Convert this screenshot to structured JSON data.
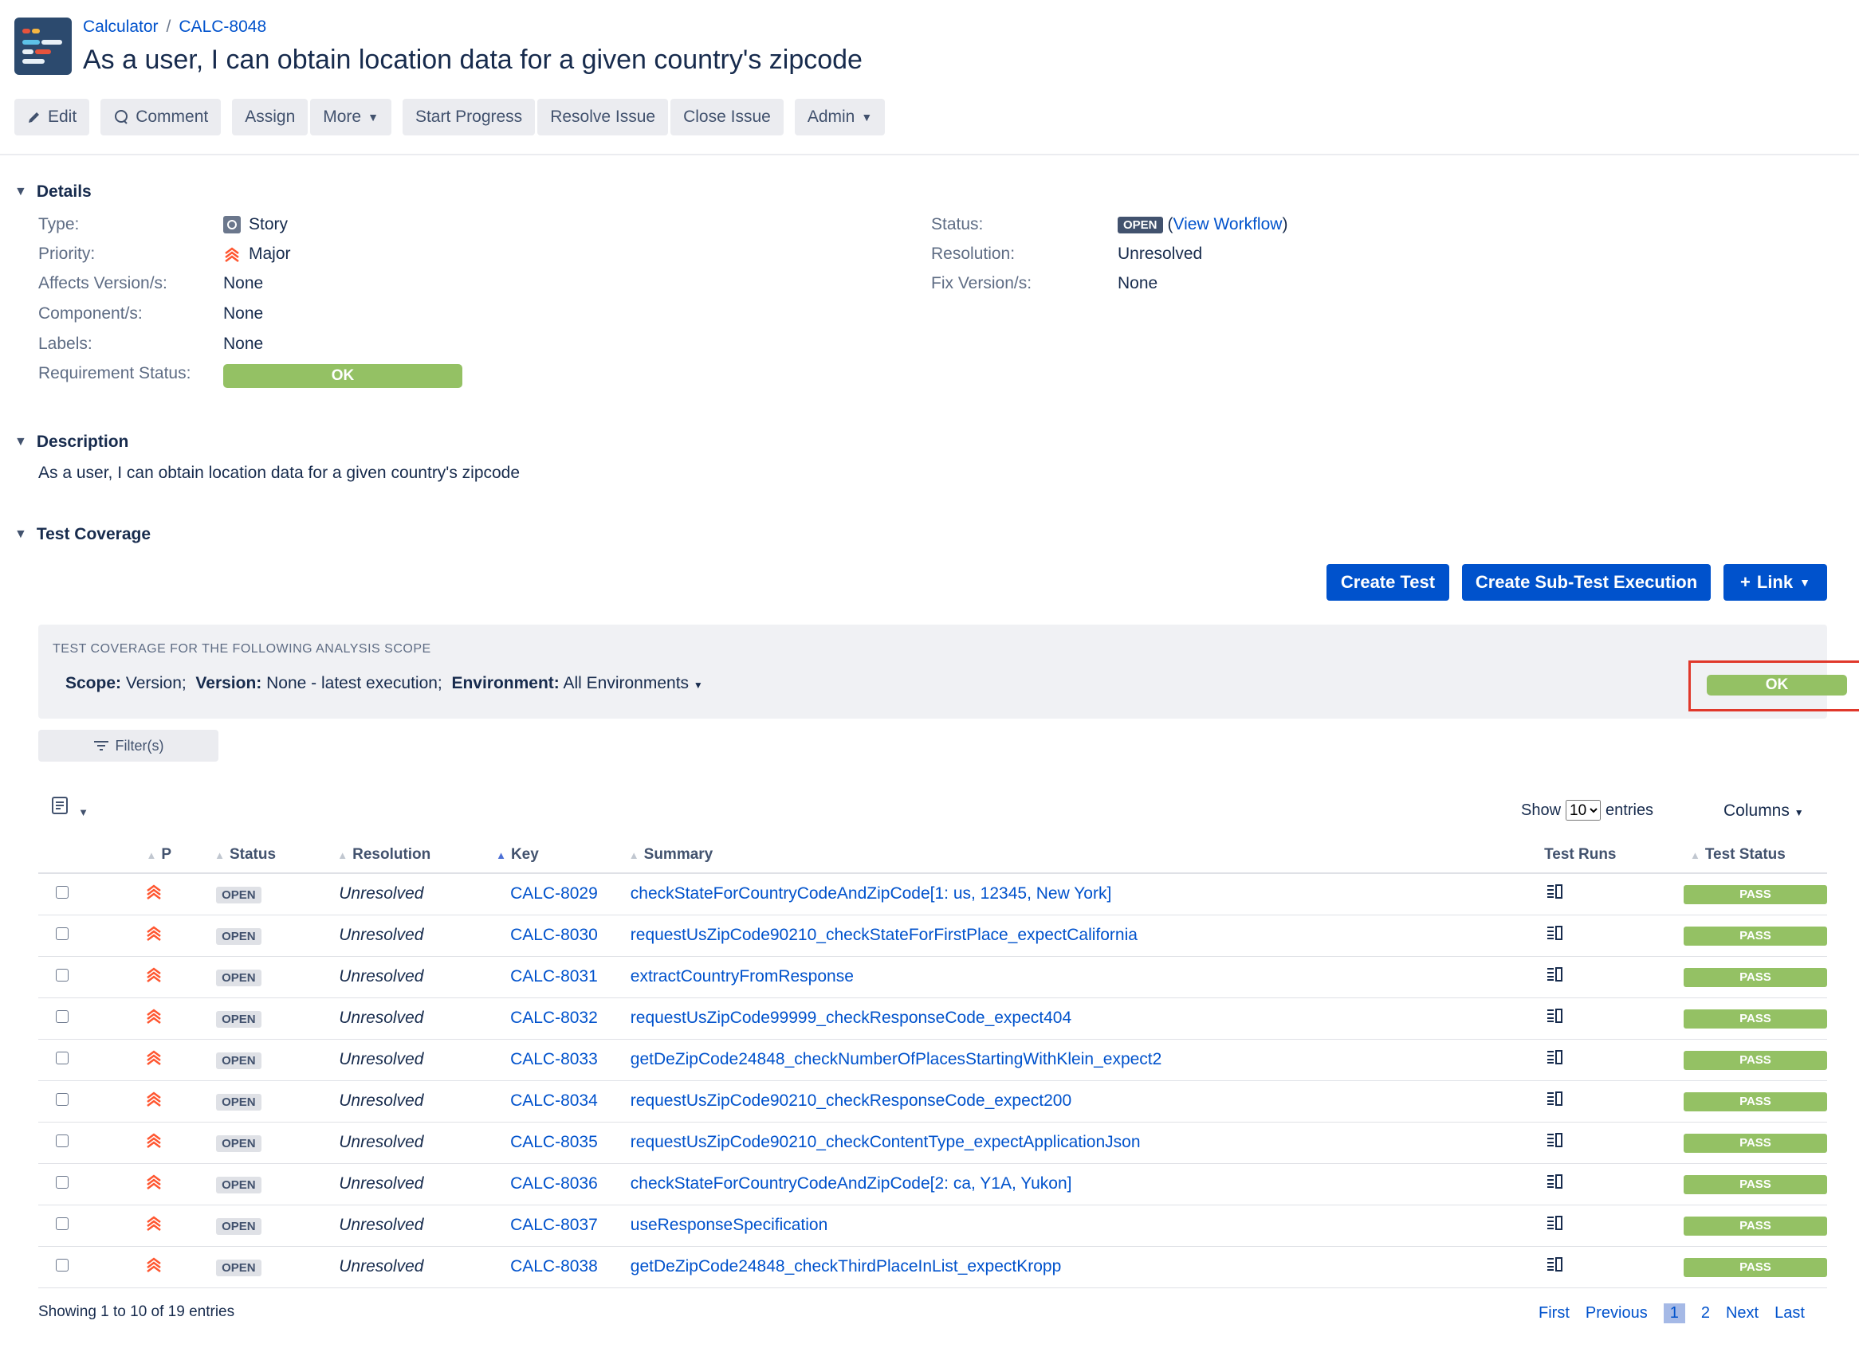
{
  "breadcrumb": {
    "project": "Calculator",
    "separator": "/",
    "issue_key": "CALC-8048"
  },
  "issue_title": "As a user, I can obtain location data for a given country's zipcode",
  "toolbar": {
    "edit": "Edit",
    "comment": "Comment",
    "assign": "Assign",
    "more": "More",
    "start_progress": "Start Progress",
    "resolve_issue": "Resolve Issue",
    "close_issue": "Close Issue",
    "admin": "Admin"
  },
  "details": {
    "heading": "Details",
    "type_label": "Type:",
    "type_value": "Story",
    "priority_label": "Priority:",
    "priority_value": "Major",
    "affects_label": "Affects Version/s:",
    "affects_value": "None",
    "component_label": "Component/s:",
    "component_value": "None",
    "labels_label": "Labels:",
    "labels_value": "None",
    "req_status_label": "Requirement Status:",
    "req_status_value": "OK",
    "status_label": "Status:",
    "status_value": "OPEN",
    "view_workflow": "View Workflow",
    "resolution_label": "Resolution:",
    "resolution_value": "Unresolved",
    "fix_label": "Fix Version/s:",
    "fix_value": "None"
  },
  "description": {
    "heading": "Description",
    "text": "As a user, I can obtain location data for a given country's zipcode"
  },
  "test_coverage": {
    "heading": "Test Coverage",
    "create_test": "Create Test",
    "create_sub": "Create Sub-Test Execution",
    "link": "Link",
    "scope_caption": "TEST COVERAGE FOR THE FOLLOWING ANALYSIS SCOPE",
    "scope_label": "Scope:",
    "scope_value": "Version;",
    "version_label": "Version:",
    "version_value": "None - latest execution;",
    "env_label": "Environment:",
    "env_value": "All Environments",
    "coverage_status": "OK",
    "filter": "Filter(s)"
  },
  "table_controls": {
    "show": "Show",
    "entries_value": "10",
    "entries": "entries",
    "columns": "Columns"
  },
  "table": {
    "headers": {
      "p": "P",
      "status": "Status",
      "resolution": "Resolution",
      "key": "Key",
      "summary": "Summary",
      "test_runs": "Test Runs",
      "test_status": "Test Status"
    },
    "rows": [
      {
        "status": "OPEN",
        "resolution": "Unresolved",
        "key": "CALC-8029",
        "summary": "checkStateForCountryCodeAndZipCode[1: us, 12345, New York]",
        "test_status": "PASS"
      },
      {
        "status": "OPEN",
        "resolution": "Unresolved",
        "key": "CALC-8030",
        "summary": "requestUsZipCode90210_checkStateForFirstPlace_expectCalifornia",
        "test_status": "PASS"
      },
      {
        "status": "OPEN",
        "resolution": "Unresolved",
        "key": "CALC-8031",
        "summary": "extractCountryFromResponse",
        "test_status": "PASS"
      },
      {
        "status": "OPEN",
        "resolution": "Unresolved",
        "key": "CALC-8032",
        "summary": "requestUsZipCode99999_checkResponseCode_expect404",
        "test_status": "PASS"
      },
      {
        "status": "OPEN",
        "resolution": "Unresolved",
        "key": "CALC-8033",
        "summary": "getDeZipCode24848_checkNumberOfPlacesStartingWithKlein_expect2",
        "test_status": "PASS"
      },
      {
        "status": "OPEN",
        "resolution": "Unresolved",
        "key": "CALC-8034",
        "summary": "requestUsZipCode90210_checkResponseCode_expect200",
        "test_status": "PASS"
      },
      {
        "status": "OPEN",
        "resolution": "Unresolved",
        "key": "CALC-8035",
        "summary": "requestUsZipCode90210_checkContentType_expectApplicationJson",
        "test_status": "PASS"
      },
      {
        "status": "OPEN",
        "resolution": "Unresolved",
        "key": "CALC-8036",
        "summary": "checkStateForCountryCodeAndZipCode[2: ca, Y1A, Yukon]",
        "test_status": "PASS"
      },
      {
        "status": "OPEN",
        "resolution": "Unresolved",
        "key": "CALC-8037",
        "summary": "useResponseSpecification",
        "test_status": "PASS"
      },
      {
        "status": "OPEN",
        "resolution": "Unresolved",
        "key": "CALC-8038",
        "summary": "getDeZipCode24848_checkThirdPlaceInList_expectKropp",
        "test_status": "PASS"
      }
    ]
  },
  "footer": {
    "showing": "Showing 1 to 10 of 19 entries",
    "first": "First",
    "previous": "Previous",
    "page1": "1",
    "page2": "2",
    "next": "Next",
    "last": "Last"
  },
  "colors": {
    "primary": "#0052cc",
    "ok_green": "#94c164",
    "highlight_red": "#e0382b",
    "priority": "#ff5630"
  }
}
